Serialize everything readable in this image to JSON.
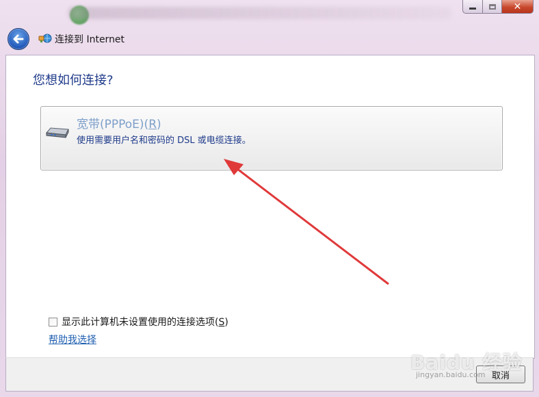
{
  "window": {
    "title": "连接到 Internet",
    "close_glyph": "✕"
  },
  "nav": {
    "back_icon": "back-arrow-icon",
    "title_icon": "network-connection-icon"
  },
  "page": {
    "heading": "您想如何连接?"
  },
  "option": {
    "title_main": "宽带(PPPoE)(",
    "title_accel": "R",
    "title_end": ")",
    "description": "使用需要用户名和密码的 DSL 或电缆连接。",
    "icon": "broadband-modem-icon"
  },
  "options_panel": {
    "checkbox_label_main": "显示此计算机未设置使用的连接选项(",
    "checkbox_accel": "S",
    "checkbox_label_end": ")",
    "checkbox_checked": false,
    "help_link": "帮助我选择"
  },
  "footer": {
    "cancel_label": "取消"
  },
  "watermark": {
    "text": "Baidu 经验",
    "sub": "jingyan.baidu.com"
  },
  "colors": {
    "heading": "#1e3a8a",
    "option_title": "#7d9fca",
    "link": "#1f5fb0",
    "annotation_arrow": "#e0393a"
  }
}
